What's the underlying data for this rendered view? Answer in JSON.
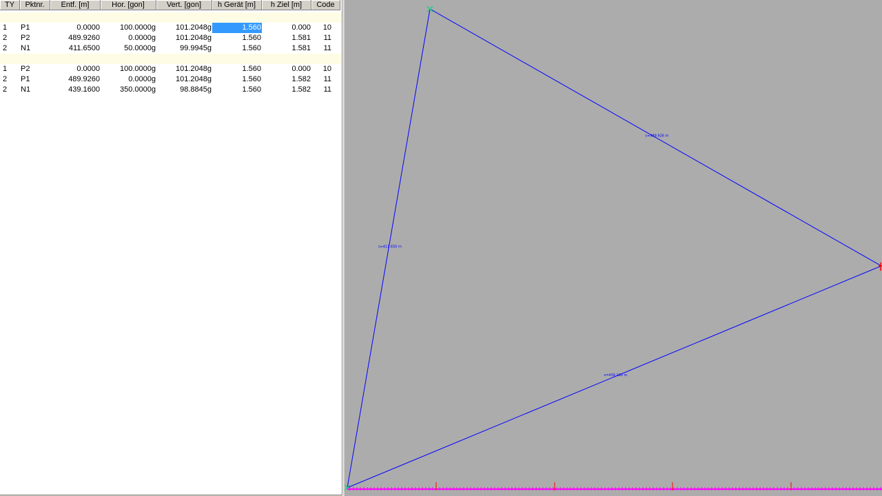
{
  "table": {
    "columns": [
      "TY",
      "Pktnr.",
      "Entf. [m]",
      "Hor. [gon]",
      "Vert. [gon]",
      "h Gerät [m]",
      "h Ziel [m]",
      "Code"
    ],
    "groups": [
      {
        "rows": [
          [
            "1",
            "P1",
            "0.0000",
            "100.0000g",
            "101.2048g",
            "1.560",
            "0.000",
            "10"
          ],
          [
            "2",
            "P2",
            "489.9260",
            "0.0000g",
            "101.2048g",
            "1.560",
            "1.581",
            "11"
          ],
          [
            "2",
            "N1",
            "411.6500",
            "50.0000g",
            "99.9945g",
            "1.560",
            "1.581",
            "11"
          ]
        ]
      },
      {
        "rows": [
          [
            "1",
            "P2",
            "0.0000",
            "100.0000g",
            "101.2048g",
            "1.560",
            "0.000",
            "10"
          ],
          [
            "2",
            "P1",
            "489.9260",
            "0.0000g",
            "101.2048g",
            "1.560",
            "1.582",
            "11"
          ],
          [
            "2",
            "N1",
            "439.1600",
            "350.0000g",
            "98.8845g",
            "1.560",
            "1.582",
            "11"
          ]
        ]
      }
    ],
    "selected_cell": {
      "group": 0,
      "row": 0,
      "col": 5
    }
  },
  "plot": {
    "background": "#acacac",
    "line_color": "#0000ff",
    "point_color": "#22cc88",
    "axis_tick_color": "#ff00ff",
    "major_tick_color": "#ff0000",
    "edge_labels": [
      "s=489.926 m",
      "s=411.650 m",
      "s=439.160 m"
    ]
  }
}
